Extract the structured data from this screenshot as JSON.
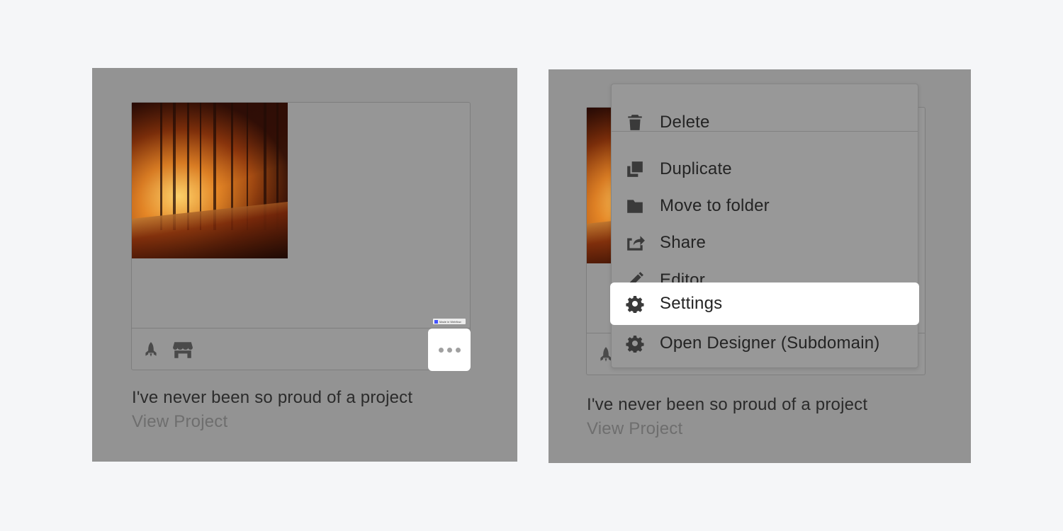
{
  "left_panel": {
    "project_title": "I've never been so proud of a project",
    "project_link": "View Project",
    "badge_text": "Made in Webflow",
    "footer_icons": [
      "rocket-icon",
      "storefront-icon"
    ],
    "more_button_icon": "ellipsis-icon"
  },
  "right_panel": {
    "project_title": "I've never been so proud of a project",
    "project_link": "View Project",
    "menu": {
      "items": [
        {
          "label": "Delete",
          "icon": "trash-icon"
        },
        {
          "label": "Duplicate",
          "icon": "duplicate-icon"
        },
        {
          "label": "Move to folder",
          "icon": "folder-icon"
        },
        {
          "label": "Share",
          "icon": "share-icon"
        },
        {
          "label": "Editor",
          "icon": "pencil-icon"
        },
        {
          "label": "Settings",
          "icon": "gear-icon",
          "highlighted": true
        },
        {
          "label": "Open Designer (Subdomain)",
          "icon": "gear-icon"
        }
      ]
    }
  },
  "colors": {
    "page_background": "#f5f6f8",
    "overlay": "#939393",
    "highlight": "#ffffff",
    "icon": "#3a3a3a"
  }
}
